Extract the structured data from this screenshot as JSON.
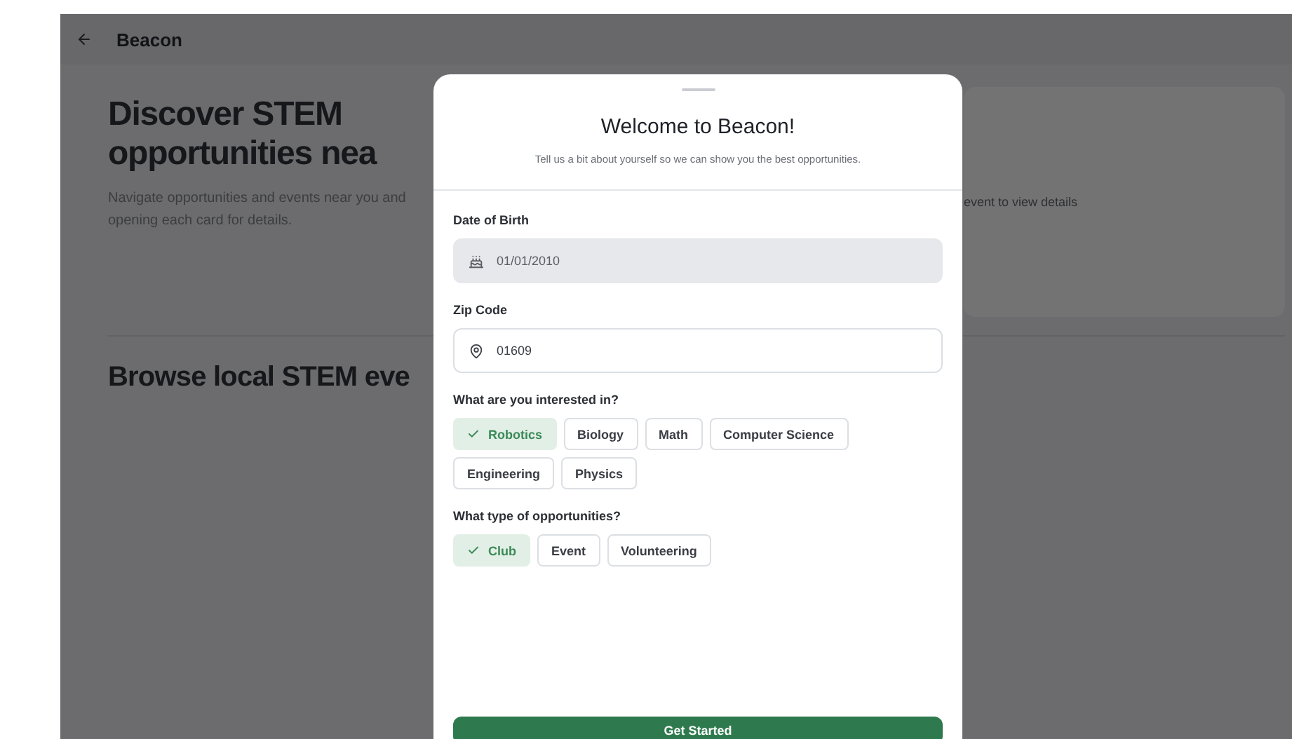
{
  "header": {
    "title": "Beacon"
  },
  "background": {
    "heading": "Discover STEM opportunities nea",
    "description": "Navigate opportunities and events near you and opening each card for details.",
    "card_text": "event to view details",
    "section_heading": "Browse local STEM eve"
  },
  "modal": {
    "title": "Welcome to Beacon!",
    "subtitle": "Tell us a bit about yourself so we can show you the best opportunities.",
    "fields": [
      {
        "kind": "date",
        "label": "Date of Birth",
        "value": "01/01/2010",
        "disabled": true
      },
      {
        "kind": "location",
        "label": "Zip Code",
        "value": "01609",
        "disabled": false
      }
    ],
    "groups": [
      {
        "label": "What are you interested in?",
        "options": [
          {
            "label": "Robotics",
            "selected": true
          },
          {
            "label": "Biology",
            "selected": false
          },
          {
            "label": "Math",
            "selected": false
          },
          {
            "label": "Computer Science",
            "selected": false
          },
          {
            "label": "Engineering",
            "selected": false
          },
          {
            "label": "Physics",
            "selected": false
          }
        ]
      },
      {
        "label": "What type of opportunities?",
        "options": [
          {
            "label": "Club",
            "selected": true
          },
          {
            "label": "Event",
            "selected": false
          },
          {
            "label": "Volunteering",
            "selected": false
          }
        ]
      }
    ],
    "button": "Get Started"
  }
}
